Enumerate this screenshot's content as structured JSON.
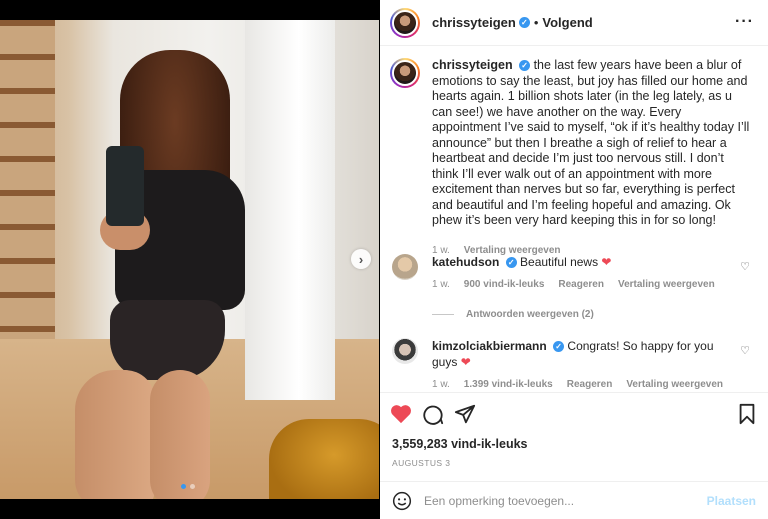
{
  "header": {
    "username": "chrissyteigen",
    "separator": "•",
    "follow_label": "Volgend",
    "more_icon": "more-icon"
  },
  "caption": {
    "username": "chrissyteigen",
    "text": "the last few years have been a blur of emotions to say the least, but joy has filled our home and hearts again. 1 billion shots later (in the leg lately, as u can see!) we have another on the way. Every appointment I’ve said to myself, “ok if it’s healthy today I’ll announce” but then I breathe a sigh of relief to hear a heartbeat and decide I’m just too nervous still. I don’t think I’ll ever walk out of an appointment with more excitement than nerves but so far, everything is perfect and beautiful and I’m feeling hopeful and amazing. Ok phew it’s been very hard keeping this in for so long!",
    "time": "1 w.",
    "translate": "Vertaling weergeven"
  },
  "comments": [
    {
      "username": "katehudson",
      "text": "Beautiful news",
      "time": "1 w.",
      "likes": "900 vind-ik-leuks",
      "reply": "Reageren",
      "translate": "Vertaling weergeven"
    },
    {
      "username": "kimzolciakbiermann",
      "text": "Congrats! So happy for you guys",
      "time": "1 w.",
      "likes": "1.399 vind-ik-leuks",
      "reply": "Reageren",
      "translate": "Vertaling weergeven"
    }
  ],
  "view_replies": "Antwoorden weergeven (2)",
  "likes_count": "3,559,283 vind-ik-leuks",
  "date": "AUGUSTUS 3",
  "add_comment": {
    "placeholder": "Een opmerking toevoegen...",
    "post_label": "Plaatsen"
  },
  "colors": {
    "like_red": "#ed4956",
    "verified_blue": "#3897f0",
    "post_disabled": "#b2dffc"
  }
}
